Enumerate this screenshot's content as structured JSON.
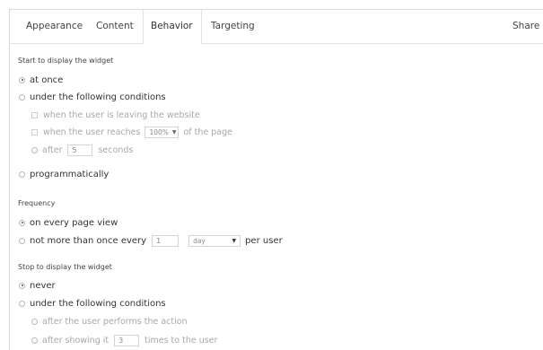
{
  "tabs": [
    {
      "label": "Appearance",
      "active": false
    },
    {
      "label": "Content",
      "active": false
    },
    {
      "label": "Behavior",
      "active": true
    },
    {
      "label": "Targeting",
      "active": false
    }
  ],
  "share_label": "Share",
  "start": {
    "heading": "Start to display the widget",
    "at_once": "at once",
    "under_conditions": "under the following conditions",
    "leaving": "when the user is leaving the website",
    "reaches_prefix": "when the user reaches",
    "reaches_value": "100%",
    "reaches_suffix": "of the page",
    "after_prefix": "after",
    "after_value": "5",
    "after_suffix": "seconds",
    "programmatically": "programmatically"
  },
  "frequency": {
    "heading": "Frequency",
    "every_view": "on every page view",
    "not_more_prefix": "not more than once every",
    "not_more_value": "1",
    "period_value": "day",
    "per_user": "per user"
  },
  "stop": {
    "heading": "Stop to display the widget",
    "never": "never",
    "under_conditions": "under the following conditions",
    "performs_action": "after the user performs the action",
    "showing_prefix": "after showing it",
    "showing_value": "3",
    "showing_suffix": "times to the user"
  },
  "colors": {
    "muted_text": "#a8a8a8",
    "border": "#dcdcdc"
  }
}
